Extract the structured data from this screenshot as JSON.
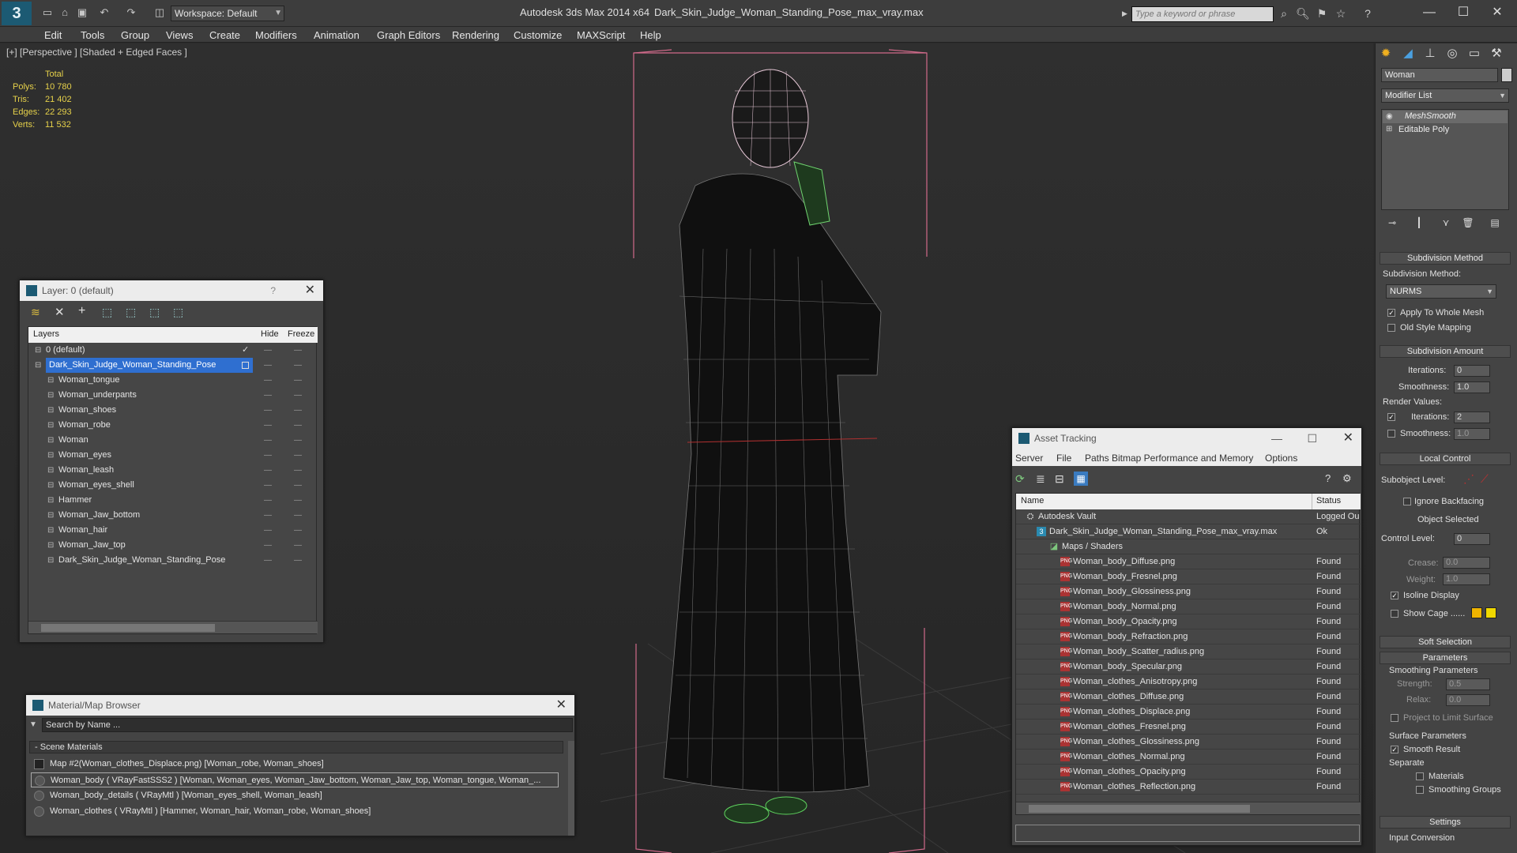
{
  "titlebar": {
    "logo": "3",
    "workspace": "Workspace: Default",
    "app_title": "Autodesk 3ds Max  2014 x64",
    "file_title": "Dark_Skin_Judge_Woman_Standing_Pose_max_vray.max",
    "search_placeholder": "Type a keyword or phrase"
  },
  "menu": [
    "Edit",
    "Tools",
    "Group",
    "Views",
    "Create",
    "Modifiers",
    "Animation",
    "Graph Editors",
    "Rendering",
    "Customize",
    "MAXScript",
    "Help"
  ],
  "viewport": {
    "label": "[+] [Perspective ] [Shaded + Edged Faces ]",
    "stats": {
      "header": "Total",
      "rows": [
        {
          "label": "Polys:",
          "value": "10 780"
        },
        {
          "label": "Tris:",
          "value": "21 402"
        },
        {
          "label": "Edges:",
          "value": "22 293"
        },
        {
          "label": "Verts:",
          "value": "11 532"
        }
      ]
    }
  },
  "command_panel": {
    "object_name": "Woman",
    "modifier_list": "Modifier List",
    "stack": [
      "MeshSmooth",
      "Editable Poly"
    ],
    "subdivision_method": {
      "title": "Subdivision Method",
      "label": "Subdivision Method:",
      "value": "NURMS",
      "apply_whole": "Apply To Whole Mesh",
      "old_style": "Old Style Mapping"
    },
    "subdivision_amount": {
      "title": "Subdivision Amount",
      "iterations_label": "Iterations:",
      "iterations": "0",
      "smoothness_label": "Smoothness:",
      "smoothness": "1.0",
      "render_values": "Render Values:",
      "r_iterations_label": "Iterations:",
      "r_iterations": "2",
      "r_smoothness_label": "Smoothness:",
      "r_smoothness": "1.0"
    },
    "local_control": {
      "title": "Local Control",
      "subobject": "Subobject Level:",
      "ignore_backfacing": "Ignore Backfacing",
      "object_selected": "Object Selected",
      "control_level_label": "Control Level:",
      "control_level": "0",
      "crease_label": "Crease:",
      "crease": "0.0",
      "weight_label": "Weight:",
      "weight": "1.0",
      "isoline": "Isoline Display",
      "show_cage": "Show Cage ......",
      "cage_color1": "#f0b400",
      "cage_color2": "#f0d800"
    },
    "soft_selection": "Soft Selection",
    "parameters": {
      "title": "Parameters",
      "smoothing": "Smoothing Parameters",
      "strength_label": "Strength:",
      "strength": "0.5",
      "relax_label": "Relax:",
      "relax": "0.0",
      "project": "Project to Limit Surface",
      "surface": "Surface Parameters",
      "smooth_result": "Smooth Result",
      "separate": "Separate",
      "materials": "Materials",
      "smoothing_groups": "Smoothing Groups"
    },
    "settings": {
      "title": "Settings",
      "input_conversion": "Input Conversion"
    }
  },
  "layer_panel": {
    "title": "Layer: 0 (default)",
    "help": "?",
    "col_layers": "Layers",
    "col_hide": "Hide",
    "col_freeze": "Freeze",
    "layers": [
      {
        "name": "0 (default)",
        "level": 0
      },
      {
        "name": "Dark_Skin_Judge_Woman_Standing_Pose",
        "level": 0,
        "selected": true
      },
      {
        "name": "Woman_tongue",
        "level": 1
      },
      {
        "name": "Woman_underpants",
        "level": 1
      },
      {
        "name": "Woman_shoes",
        "level": 1
      },
      {
        "name": "Woman_robe",
        "level": 1
      },
      {
        "name": "Woman",
        "level": 1
      },
      {
        "name": "Woman_eyes",
        "level": 1
      },
      {
        "name": "Woman_leash",
        "level": 1
      },
      {
        "name": "Woman_eyes_shell",
        "level": 1
      },
      {
        "name": "Hammer",
        "level": 1
      },
      {
        "name": "Woman_Jaw_bottom",
        "level": 1
      },
      {
        "name": "Woman_hair",
        "level": 1
      },
      {
        "name": "Woman_Jaw_top",
        "level": 1
      },
      {
        "name": "Dark_Skin_Judge_Woman_Standing_Pose",
        "level": 1
      }
    ]
  },
  "material_browser": {
    "title": "Material/Map Browser",
    "search_placeholder": "Search by Name ...",
    "section": "Scene Materials",
    "items": [
      "Map #2(Woman_clothes_Displace.png) [Woman_robe, Woman_shoes]",
      "Woman_body  ( VRayFastSSS2 ) [Woman, Woman_eyes, Woman_Jaw_bottom, Woman_Jaw_top, Woman_tongue, Woman_...",
      "Woman_body_details  ( VRayMtl ) [Woman_eyes_shell, Woman_leash]",
      "Woman_clothes  ( VRayMtl ) [Hammer, Woman_hair, Woman_robe, Woman_shoes]"
    ]
  },
  "asset_tracking": {
    "title": "Asset Tracking",
    "menu": [
      "Server",
      "File",
      "Paths",
      "Bitmap Performance and Memory",
      "Options"
    ],
    "col_name": "Name",
    "col_status": "Status",
    "rows": [
      {
        "name": "Autodesk Vault",
        "status": "Logged Ou",
        "level": 0
      },
      {
        "name": "Dark_Skin_Judge_Woman_Standing_Pose_max_vray.max",
        "status": "Ok",
        "level": 1
      },
      {
        "name": "Maps / Shaders",
        "status": "",
        "level": 2
      },
      {
        "name": "Woman_body_Diffuse.png",
        "status": "Found",
        "level": 3
      },
      {
        "name": "Woman_body_Fresnel.png",
        "status": "Found",
        "level": 3
      },
      {
        "name": "Woman_body_Glossiness.png",
        "status": "Found",
        "level": 3
      },
      {
        "name": "Woman_body_Normal.png",
        "status": "Found",
        "level": 3
      },
      {
        "name": "Woman_body_Opacity.png",
        "status": "Found",
        "level": 3
      },
      {
        "name": "Woman_body_Refraction.png",
        "status": "Found",
        "level": 3
      },
      {
        "name": "Woman_body_Scatter_radius.png",
        "status": "Found",
        "level": 3
      },
      {
        "name": "Woman_body_Specular.png",
        "status": "Found",
        "level": 3
      },
      {
        "name": "Woman_clothes_Anisotropy.png",
        "status": "Found",
        "level": 3
      },
      {
        "name": "Woman_clothes_Diffuse.png",
        "status": "Found",
        "level": 3
      },
      {
        "name": "Woman_clothes_Displace.png",
        "status": "Found",
        "level": 3
      },
      {
        "name": "Woman_clothes_Fresnel.png",
        "status": "Found",
        "level": 3
      },
      {
        "name": "Woman_clothes_Glossiness.png",
        "status": "Found",
        "level": 3
      },
      {
        "name": "Woman_clothes_Normal.png",
        "status": "Found",
        "level": 3
      },
      {
        "name": "Woman_clothes_Opacity.png",
        "status": "Found",
        "level": 3
      },
      {
        "name": "Woman_clothes_Reflection.png",
        "status": "Found",
        "level": 3
      }
    ]
  }
}
